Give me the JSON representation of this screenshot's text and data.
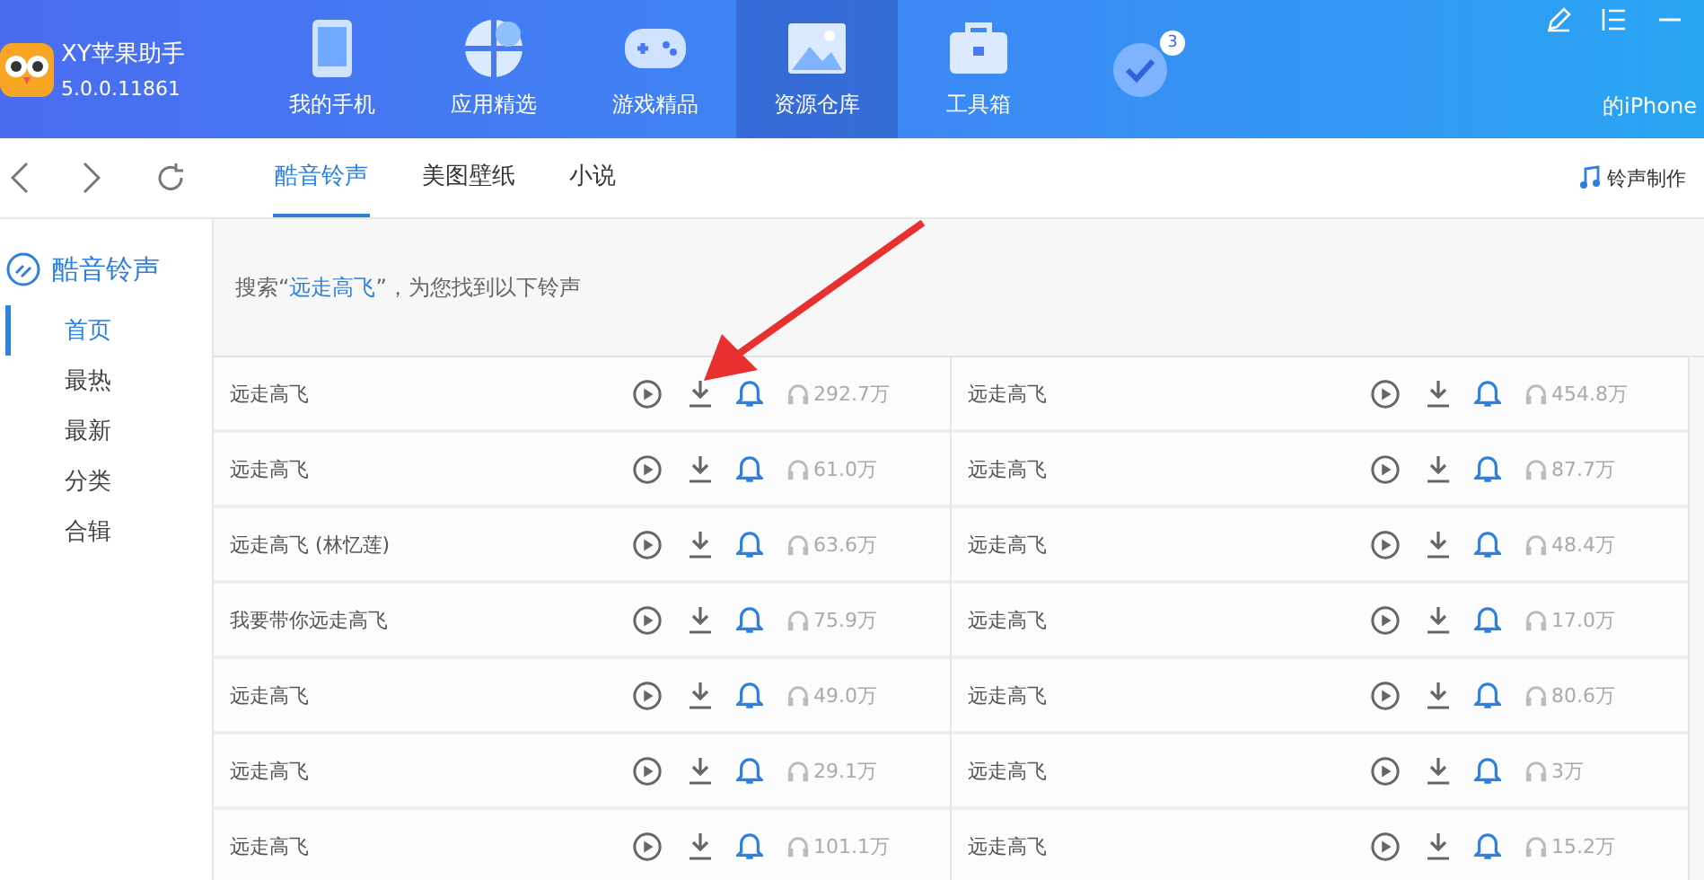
{
  "app": {
    "name": "XY苹果助手",
    "version": "5.0.0.11861"
  },
  "nav": [
    {
      "label": "我的手机",
      "kind": "phone",
      "selected": false
    },
    {
      "label": "应用精选",
      "kind": "apps",
      "selected": false
    },
    {
      "label": "游戏精品",
      "kind": "gamepad",
      "selected": false
    },
    {
      "label": "资源仓库",
      "kind": "picture",
      "selected": true
    },
    {
      "label": "工具箱",
      "kind": "toolbox",
      "selected": false
    },
    {
      "kind": "check",
      "badge": "3",
      "selected": false
    }
  ],
  "device": "的iPhone",
  "tabs": [
    {
      "label": "酷音铃声",
      "selected": true
    },
    {
      "label": "美图壁纸",
      "selected": false
    },
    {
      "label": "小说",
      "selected": false
    }
  ],
  "make_ringtone": "铃声制作",
  "sidebar": {
    "title": "酷音铃声",
    "items": [
      {
        "label": "首页",
        "selected": true
      },
      {
        "label": "最热",
        "selected": false
      },
      {
        "label": "最新",
        "selected": false
      },
      {
        "label": "分类",
        "selected": false
      },
      {
        "label": "合辑",
        "selected": false
      }
    ]
  },
  "search_result": "搜索“**远走高飞**”，为您找到以下铃声",
  "columns": [
    {
      "rows": [
        {
          "title": "远走高飞",
          "plays": "292.7万"
        },
        {
          "title": "远走高飞",
          "plays": "61.0万"
        },
        {
          "title": "远走高飞 (林忆莲)",
          "plays": "63.6万"
        },
        {
          "title": "我要带你远走高飞",
          "plays": "75.9万"
        },
        {
          "title": "远走高飞",
          "plays": "49.0万"
        },
        {
          "title": "远走高飞",
          "plays": "29.1万"
        },
        {
          "title": "远走高飞",
          "plays": "101.1万"
        }
      ]
    },
    {
      "rows": [
        {
          "title": "远走高飞",
          "plays": "454.8万"
        },
        {
          "title": "远走高飞",
          "plays": "87.7万"
        },
        {
          "title": "远走高飞",
          "plays": "48.4万"
        },
        {
          "title": "远走高飞",
          "plays": "17.0万"
        },
        {
          "title": "远走高飞",
          "plays": "80.6万"
        },
        {
          "title": "远走高飞",
          "plays": "3万"
        },
        {
          "title": "远走高飞",
          "plays": "15.2万"
        }
      ]
    }
  ]
}
